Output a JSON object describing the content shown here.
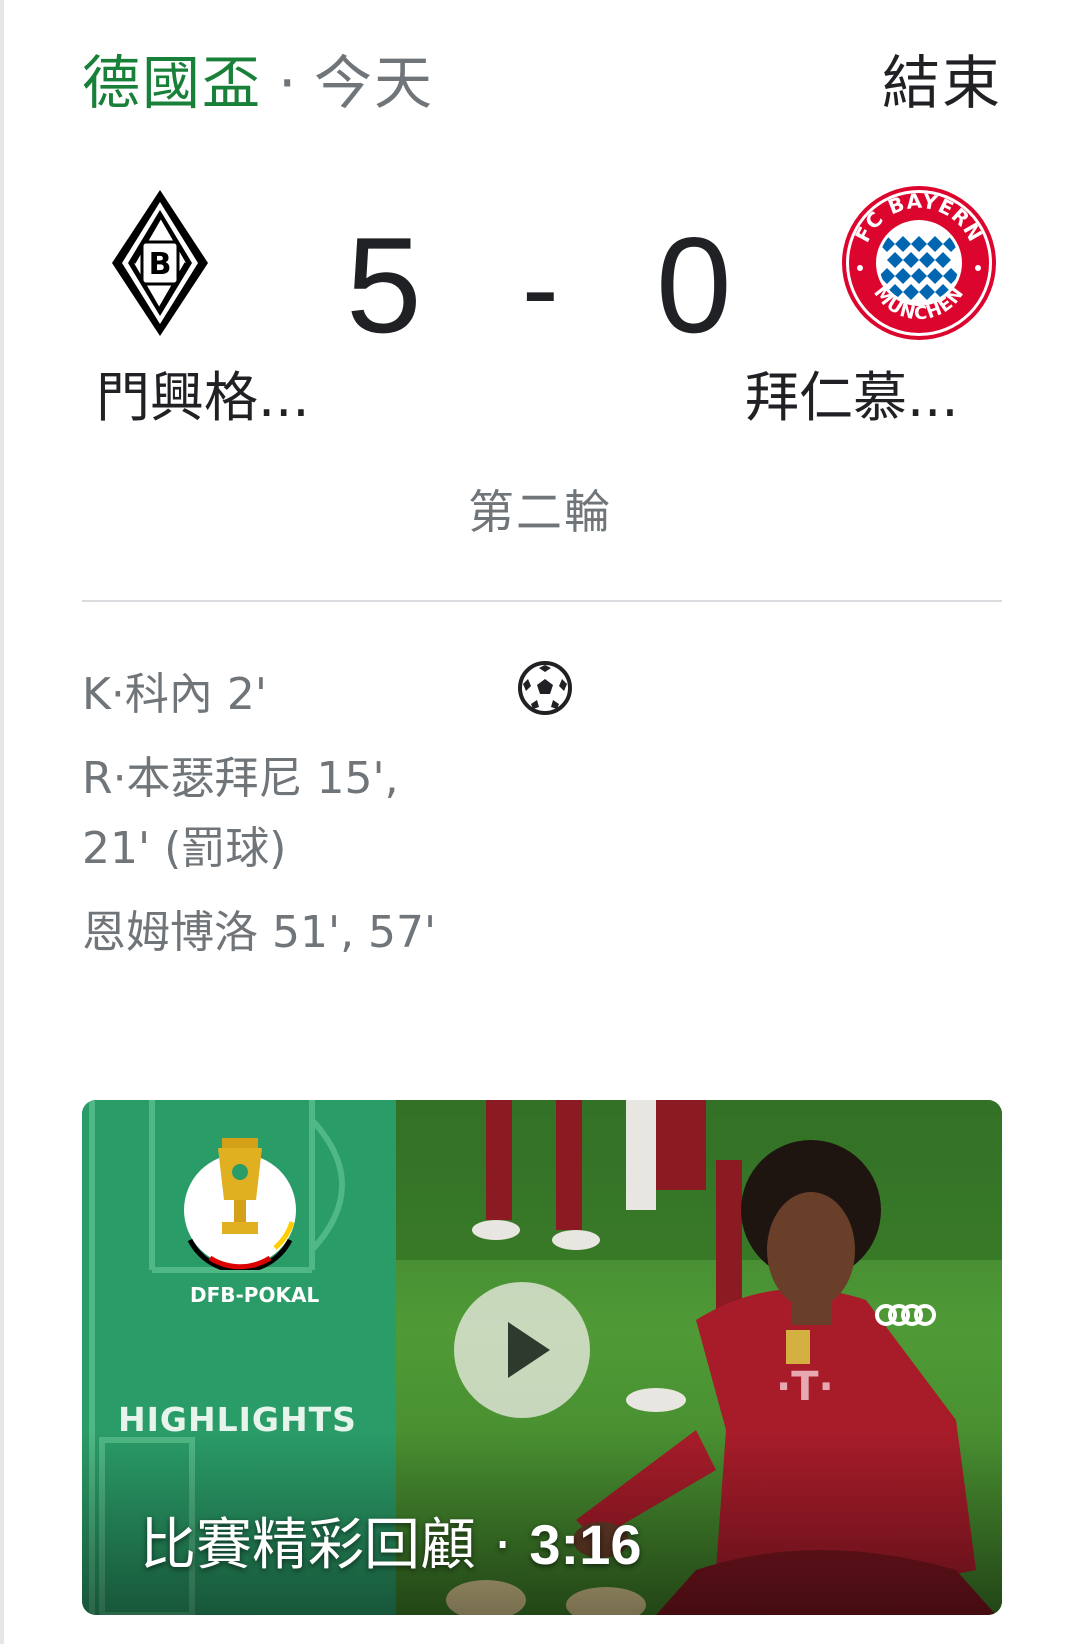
{
  "header": {
    "competition": "德國盃",
    "separator": "·",
    "date": "今天",
    "status": "結束"
  },
  "match": {
    "home": {
      "name": "門興格...",
      "score": "5",
      "crest_icon": "borussia-mgladbach-crest-icon"
    },
    "away": {
      "name": "拜仁慕...",
      "score": "0",
      "crest_icon": "fc-bayern-munchen-crest-icon",
      "crest_text": "FC BAYERN MÜNCHEN"
    },
    "dash": "-",
    "round": "第二輪"
  },
  "scorers": {
    "icon": "soccer-ball-icon",
    "home": [
      "K·科內 2'",
      "R·本瑟拜尼 15', 21' (罰球)",
      "恩姆博洛 51', 57'"
    ]
  },
  "video": {
    "badge_text": "DFB-POKAL",
    "highlights_label": "HIGHLIGHTS",
    "caption": "比賽精彩回顧",
    "caption_sep": " · ",
    "duration": "3:16",
    "colors": {
      "panel": "#2a9c68",
      "pitch": "#4f9a36",
      "kit": "#b01e2e"
    }
  },
  "colors": {
    "competition": "#188038",
    "secondary_text": "#70757a",
    "primary_text": "#202124",
    "bayern_red": "#dc052d",
    "bayern_blue": "#0066b2"
  }
}
